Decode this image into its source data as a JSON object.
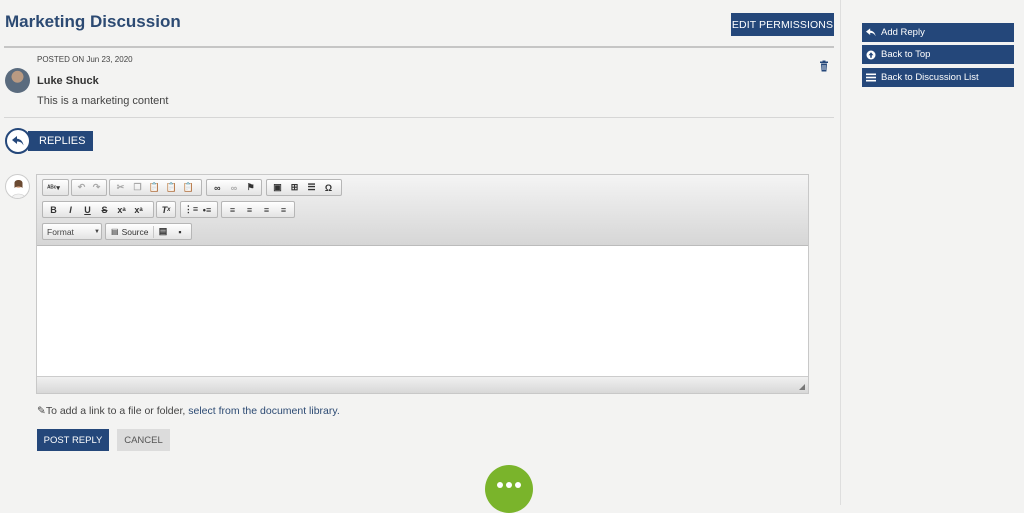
{
  "discussion": {
    "title": "Marketing Discussion",
    "edit_permissions_label": "EDIT PERMISSIONS"
  },
  "post": {
    "posted_on": "POSTED ON Jun 23, 2020",
    "author": "Luke Shuck",
    "content": "This is a marketing content"
  },
  "replies": {
    "label": "REPLIES"
  },
  "editor": {
    "format_label": "Format",
    "source_label": "Source"
  },
  "link_note": {
    "prefix": "To add a link to a file or folder, ",
    "link_text": "select from the document library."
  },
  "actions": {
    "post_reply_label": "POST REPLY",
    "cancel_label": "CANCEL"
  },
  "sidebar": {
    "items": [
      {
        "label": "Add Reply",
        "icon": "reply-icon"
      },
      {
        "label": "Back to Top",
        "icon": "arrow-up-circle-icon"
      },
      {
        "label": "Back to Discussion List",
        "icon": "list-icon"
      }
    ]
  },
  "colors": {
    "primary": "#24477a",
    "title": "#2c4a73",
    "more_button": "#7ab42b"
  }
}
